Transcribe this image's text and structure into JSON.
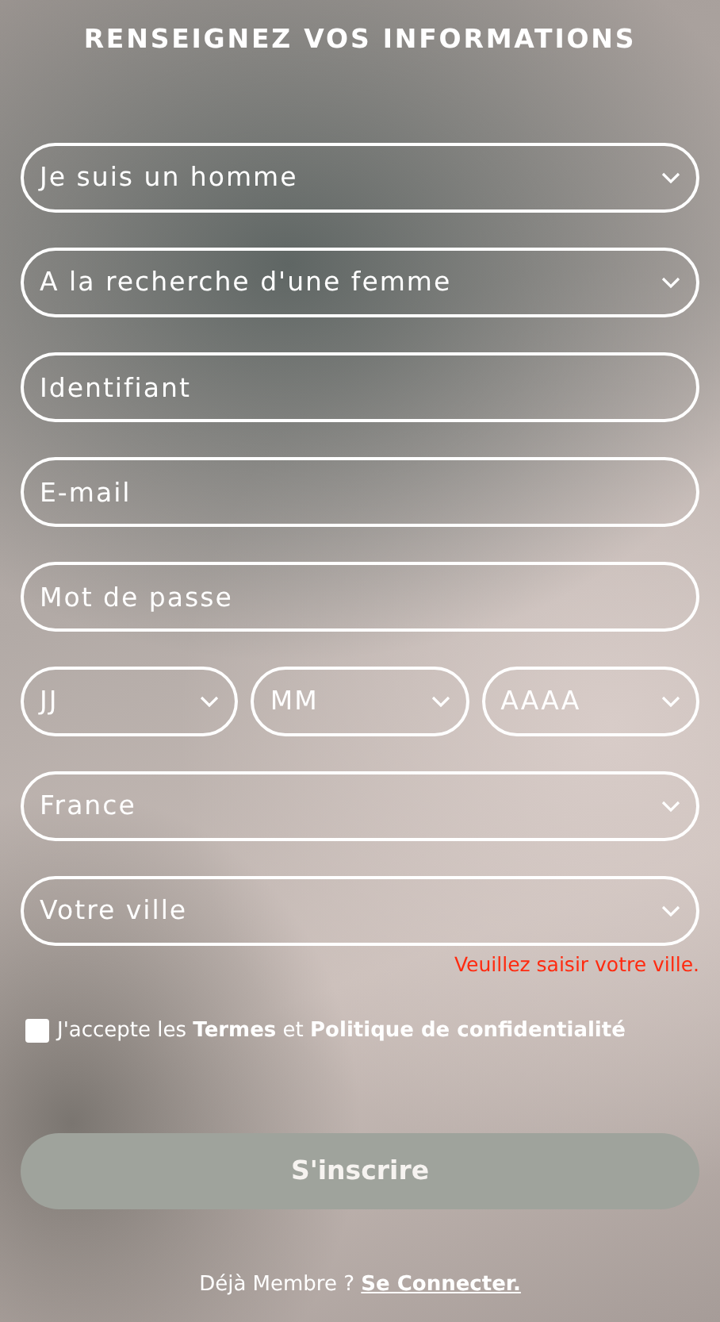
{
  "title": "RENSEIGNEZ VOS INFORMATIONS",
  "fields": [
    {
      "kind": "select",
      "value": "Je suis un homme"
    },
    {
      "kind": "select",
      "value": "A la recherche d'une femme"
    },
    {
      "kind": "input",
      "placeholder": "Identifiant"
    },
    {
      "kind": "input",
      "placeholder": "E-mail"
    },
    {
      "kind": "input",
      "placeholder": "Mot de passe"
    },
    {
      "kind": "date",
      "parts": [
        {
          "value": "JJ"
        },
        {
          "value": "MM"
        },
        {
          "value": "AAAA"
        }
      ]
    },
    {
      "kind": "select",
      "value": "France"
    },
    {
      "kind": "select",
      "value": "Votre ville",
      "error": "Veuillez saisir votre ville."
    }
  ],
  "consent": {
    "checked": false,
    "text": "J'accepte les **Termes** et **Politique de confidentialité**"
  },
  "submit": {
    "label": "S'inscrire",
    "disabled": true
  },
  "footer": {
    "text": "Déjà Membre ?",
    "link": "Se Connecter."
  }
}
